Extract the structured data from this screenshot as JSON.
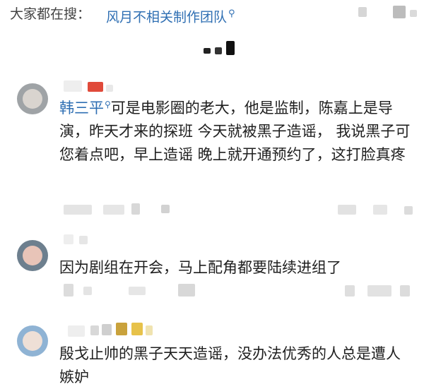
{
  "search": {
    "prefix": "大家都在搜：",
    "query": "风月不相关制作团队",
    "query_icon": "search-icon"
  },
  "comments": [
    {
      "username": "韩三平",
      "user_icon": "search-icon",
      "text": "可是电影圈的老大，他是监制，陈嘉上是导演，昨天才来的探班 今天就被黑子造谣， 我说黑子可您着点吧，早上造谣 晚上就开通预约了，这打脸真疼"
    },
    {
      "username": "",
      "text": "因为剧组在开会，马上配角都要陆续进组了"
    },
    {
      "username": "",
      "text": "殷戈止帅的黑子天天造谣，没办法优秀的人总是遭人嫉妒"
    }
  ],
  "colors": {
    "link": "#2f6fb3",
    "text": "#1f1f1f"
  }
}
